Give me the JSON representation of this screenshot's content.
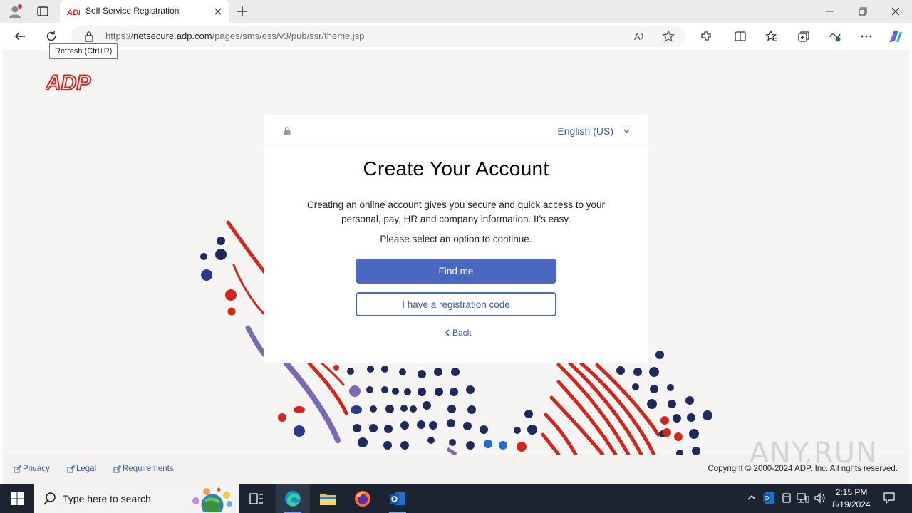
{
  "browser": {
    "tab_title": "Self Service Registration",
    "url_scheme": "https://",
    "url_host": "netsecure.adp.com",
    "url_path": "/pages/sms/ess/v3/pub/ssr/theme.jsp",
    "refresh_tooltip": "Refresh (Ctrl+R)"
  },
  "page": {
    "logo_text": "ADP",
    "language": "English (US)",
    "heading": "Create Your Account",
    "intro": "Creating an online account gives you secure and quick access to your personal, pay, HR and company information. It's easy.",
    "prompt": "Please select an option to continue.",
    "find_me_label": "Find me",
    "registration_code_label": "I have a registration code",
    "back_label": "Back"
  },
  "footer": {
    "links": [
      "Privacy",
      "Legal",
      "Requirements"
    ],
    "copyright": "Copyright © 2000-2024 ADP, Inc. All rights reserved.",
    "watermark": "ANY.RUN"
  },
  "taskbar": {
    "search_placeholder": "Type here to search",
    "time": "2:15 PM",
    "date": "8/19/2024"
  },
  "colors": {
    "adp_red": "#d0271d",
    "brand_blue": "#4a67c2",
    "link_blue": "#3b5aa8",
    "deco_navy": "#1e2a5e",
    "deco_purple": "#7a6ab3"
  }
}
